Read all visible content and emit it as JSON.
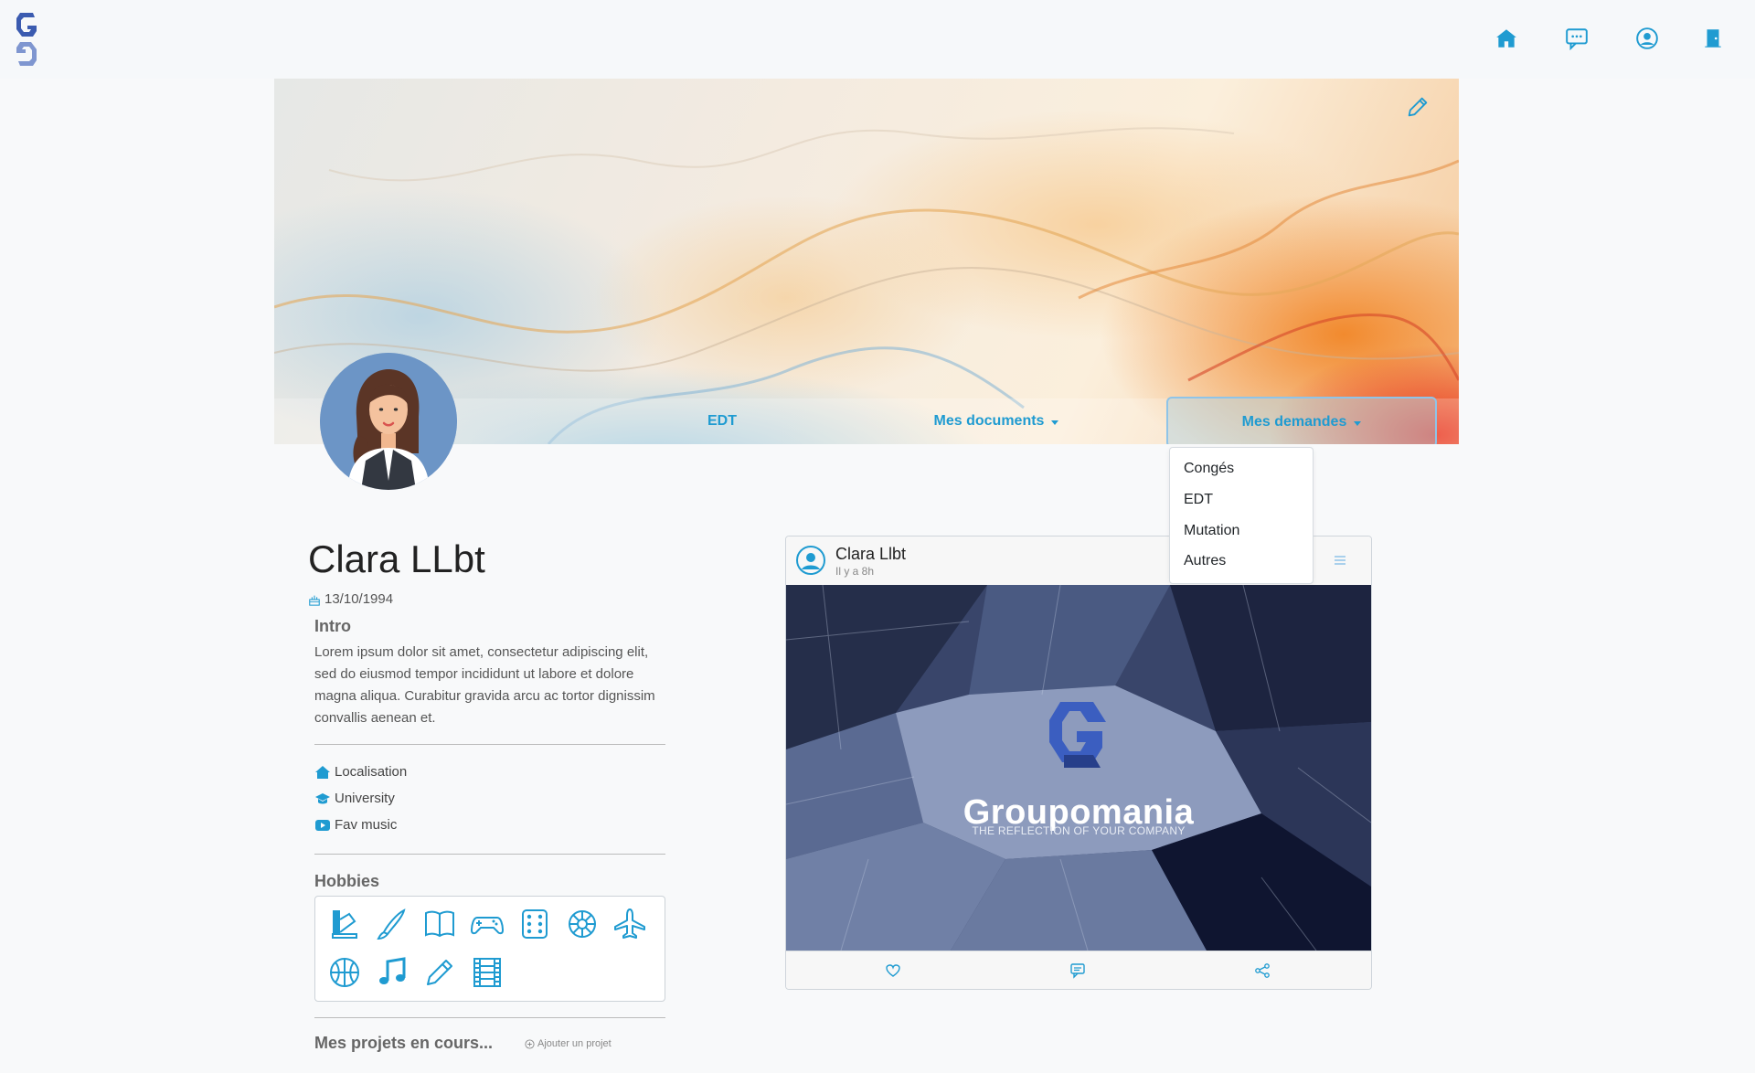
{
  "colors": {
    "accent": "#1f9bd1",
    "navbar_bg": "#f6f8fa",
    "logo_blue": "#3b5bb0"
  },
  "navbar": {
    "logo_icon": "groupomania-logo-icon",
    "icons": [
      "home-icon",
      "chat-icon",
      "profile-icon",
      "logout-door-icon"
    ]
  },
  "cover": {
    "edit_icon": "pencil-icon",
    "tabs": [
      {
        "label": "EDT"
      },
      {
        "label": "Mes documents"
      },
      {
        "label": "Mes demandes"
      }
    ]
  },
  "dropdown": {
    "items": [
      "Congés",
      "EDT",
      "Mutation",
      "Autres"
    ]
  },
  "profile": {
    "name": "Clara LLbt",
    "birthdate": "13/10/1994",
    "intro_title": "Intro",
    "intro_text": "Lorem ipsum dolor sit amet, consectetur adipiscing elit, sed do eiusmod tempor incididunt ut labore et dolore magna aliqua. Curabitur gravida arcu ac tortor dignissim convallis aenean et.",
    "details": {
      "location": "Localisation",
      "school": "University",
      "music": "Fav music"
    },
    "hobbies_title": "Hobbies",
    "hobbies": [
      "palette-icon",
      "brush-icon",
      "book-icon",
      "gamepad-icon",
      "dice-icon",
      "flower-icon",
      "airplane-icon",
      "basketball-icon",
      "music-note-icon",
      "pencil-icon",
      "film-icon"
    ],
    "projects_title": "Mes projets en cours...",
    "add_project": "Ajouter un projet"
  },
  "post": {
    "author": "Clara Llbt",
    "time": "Il y a 8h",
    "image_brand": "Groupomania",
    "image_tagline": "THE REFLECTION OF YOUR COMPANY",
    "actions": [
      "like-heart-icon",
      "comment-icon",
      "share-icon"
    ]
  }
}
